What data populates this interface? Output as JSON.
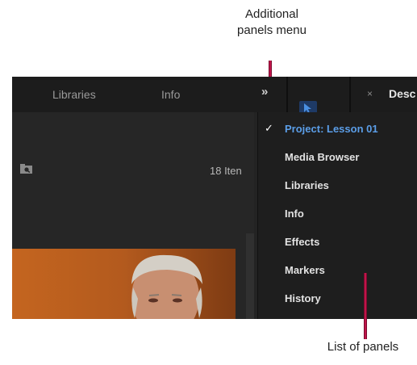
{
  "callouts": {
    "top_line1": "Additional",
    "top_line2": "panels menu",
    "bottom": "List of panels"
  },
  "tabs": {
    "libraries": "Libraries",
    "info": "Info",
    "overflow": "»",
    "close": "×",
    "desc_partial": "Desc"
  },
  "project_panel": {
    "item_count_partial": "18 Iten"
  },
  "panel_menu": {
    "items": [
      {
        "label": "Project: Lesson 01",
        "checked": true
      },
      {
        "label": "Media Browser",
        "checked": false
      },
      {
        "label": "Libraries",
        "checked": false
      },
      {
        "label": "Info",
        "checked": false
      },
      {
        "label": "Effects",
        "checked": false
      },
      {
        "label": "Markers",
        "checked": false
      },
      {
        "label": "History",
        "checked": false
      }
    ],
    "check_glyph": "✓"
  },
  "colors": {
    "callout_line": "#c0144a",
    "selected_item": "#5b9ee8",
    "panel_bg": "#232323"
  }
}
